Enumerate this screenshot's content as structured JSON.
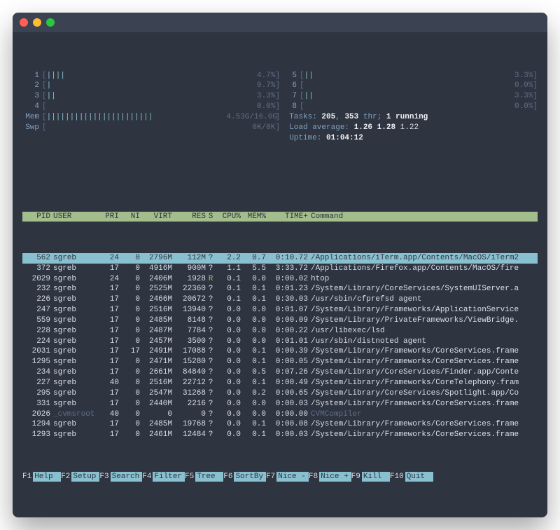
{
  "window": {
    "title": ""
  },
  "colors": {
    "bg": "#2E3440",
    "accent": "#88C0D0",
    "green": "#A3BE8C"
  },
  "cpu_meters": {
    "left": [
      {
        "id": "1",
        "bar": "||||",
        "val": "4.7%"
      },
      {
        "id": "2",
        "bar": "|",
        "val": "0.7%"
      },
      {
        "id": "3",
        "bar": "||",
        "val": "3.3%"
      },
      {
        "id": "4",
        "bar": "",
        "val": "0.0%"
      }
    ],
    "right": [
      {
        "id": "5",
        "bar": "||",
        "val": "3.3%"
      },
      {
        "id": "6",
        "bar": "",
        "val": "0.0%"
      },
      {
        "id": "7",
        "bar": "||",
        "val": "3.3%"
      },
      {
        "id": "8",
        "bar": "",
        "val": "0.0%"
      }
    ]
  },
  "mem": {
    "label": "Mem",
    "bar": "|||||||||||||||||||||||",
    "val": "4.53G/16.0G"
  },
  "swp": {
    "label": "Swp",
    "bar": "",
    "val": "0K/0K"
  },
  "tasks": {
    "label": "Tasks:",
    "procs": "205",
    "thr": "353",
    "suffix": "thr;",
    "running": "1 running"
  },
  "load": {
    "label": "Load average:",
    "a": "1.26",
    "b": "1.28",
    "c": "1.22"
  },
  "uptime": {
    "label": "Uptime:",
    "val": "01:04:12"
  },
  "columns": {
    "pid": "PID",
    "user": "USER",
    "pri": "PRI",
    "ni": "NI",
    "virt": "VIRT",
    "res": "RES",
    "s": "S",
    "cpu": "CPU%",
    "mem": "MEM%",
    "time": "TIME+",
    "cmd": "Command"
  },
  "rows": [
    {
      "sel": true,
      "pid": "562",
      "user": "sgreb",
      "pri": "24",
      "ni": "0",
      "virt": "2796M",
      "res": "112M",
      "s": "?",
      "cpu": "2.2",
      "mem": "0.7",
      "time": "0:10.72",
      "cmd": "/Applications/iTerm.app/Contents/MacOS/iTerm2"
    },
    {
      "pid": "372",
      "user": "sgreb",
      "pri": "17",
      "ni": "0",
      "virt": "4916M",
      "res": "900M",
      "s": "?",
      "cpu": "1.1",
      "mem": "5.5",
      "time": "3:33.72",
      "cmd": "/Applications/Firefox.app/Contents/MacOS/fire"
    },
    {
      "pid": "2029",
      "user": "sgreb",
      "pri": "24",
      "ni": "0",
      "virt": "2406M",
      "res": "1928",
      "s": "R",
      "cpu": "0.1",
      "mem": "0.0",
      "time": "0:00.02",
      "cmd": "htop"
    },
    {
      "pid": "232",
      "user": "sgreb",
      "pri": "17",
      "ni": "0",
      "virt": "2525M",
      "res": "22360",
      "s": "?",
      "cpu": "0.1",
      "mem": "0.1",
      "time": "0:01.23",
      "cmd": "/System/Library/CoreServices/SystemUIServer.a"
    },
    {
      "pid": "226",
      "user": "sgreb",
      "pri": "17",
      "ni": "0",
      "virt": "2466M",
      "res": "20672",
      "s": "?",
      "cpu": "0.1",
      "mem": "0.1",
      "time": "0:30.03",
      "cmd": "/usr/sbin/cfprefsd agent"
    },
    {
      "pid": "247",
      "user": "sgreb",
      "pri": "17",
      "ni": "0",
      "virt": "2516M",
      "res": "13940",
      "s": "?",
      "cpu": "0.0",
      "mem": "0.0",
      "time": "0:01.07",
      "cmd": "/System/Library/Frameworks/ApplicationService"
    },
    {
      "pid": "559",
      "user": "sgreb",
      "pri": "17",
      "ni": "0",
      "virt": "2485M",
      "res": "8148",
      "s": "?",
      "cpu": "0.0",
      "mem": "0.0",
      "time": "0:00.09",
      "cmd": "/System/Library/PrivateFrameworks/ViewBridge."
    },
    {
      "pid": "228",
      "user": "sgreb",
      "pri": "17",
      "ni": "0",
      "virt": "2487M",
      "res": "7784",
      "s": "?",
      "cpu": "0.0",
      "mem": "0.0",
      "time": "0:00.22",
      "cmd": "/usr/libexec/lsd"
    },
    {
      "pid": "224",
      "user": "sgreb",
      "pri": "17",
      "ni": "0",
      "virt": "2457M",
      "res": "3500",
      "s": "?",
      "cpu": "0.0",
      "mem": "0.0",
      "time": "0:01.01",
      "cmd": "/usr/sbin/distnoted agent"
    },
    {
      "pid": "2031",
      "user": "sgreb",
      "pri": "17",
      "ni": "17",
      "virt": "2491M",
      "res": "17088",
      "s": "?",
      "cpu": "0.0",
      "mem": "0.1",
      "time": "0:00.39",
      "cmd": "/System/Library/Frameworks/CoreServices.frame"
    },
    {
      "pid": "1295",
      "user": "sgreb",
      "pri": "17",
      "ni": "0",
      "virt": "2471M",
      "res": "15280",
      "s": "?",
      "cpu": "0.0",
      "mem": "0.1",
      "time": "0:00.05",
      "cmd": "/System/Library/Frameworks/CoreServices.frame"
    },
    {
      "pid": "234",
      "user": "sgreb",
      "pri": "17",
      "ni": "0",
      "virt": "2661M",
      "res": "84840",
      "s": "?",
      "cpu": "0.0",
      "mem": "0.5",
      "time": "0:07.26",
      "cmd": "/System/Library/CoreServices/Finder.app/Conte"
    },
    {
      "pid": "227",
      "user": "sgreb",
      "pri": "40",
      "ni": "0",
      "virt": "2516M",
      "res": "22712",
      "s": "?",
      "cpu": "0.0",
      "mem": "0.1",
      "time": "0:00.49",
      "cmd": "/System/Library/Frameworks/CoreTelephony.fram"
    },
    {
      "pid": "295",
      "user": "sgreb",
      "pri": "17",
      "ni": "0",
      "virt": "2547M",
      "res": "31268",
      "s": "?",
      "cpu": "0.0",
      "mem": "0.2",
      "time": "0:00.65",
      "cmd": "/System/Library/CoreServices/Spotlight.app/Co"
    },
    {
      "pid": "331",
      "user": "sgreb",
      "pri": "17",
      "ni": "0",
      "virt": "2440M",
      "res": "2216",
      "s": "?",
      "cpu": "0.0",
      "mem": "0.0",
      "time": "0:00.03",
      "cmd": "/System/Library/Frameworks/CoreServices.frame"
    },
    {
      "dim": true,
      "pid": "2026",
      "user": "_cvmsroot",
      "pri": "40",
      "ni": "0",
      "virt": "0",
      "res": "0",
      "s": "?",
      "cpu": "0.0",
      "mem": "0.0",
      "time": "0:00.00",
      "cmd": "CVMCompiler"
    },
    {
      "pid": "1294",
      "user": "sgreb",
      "pri": "17",
      "ni": "0",
      "virt": "2485M",
      "res": "19768",
      "s": "?",
      "cpu": "0.0",
      "mem": "0.1",
      "time": "0:00.08",
      "cmd": "/System/Library/Frameworks/CoreServices.frame"
    },
    {
      "pid": "1293",
      "user": "sgreb",
      "pri": "17",
      "ni": "0",
      "virt": "2461M",
      "res": "12484",
      "s": "?",
      "cpu": "0.0",
      "mem": "0.1",
      "time": "0:00.03",
      "cmd": "/System/Library/Frameworks/CoreServices.frame"
    }
  ],
  "fkeys": [
    {
      "k": "F1",
      "lbl": "Help"
    },
    {
      "k": "F2",
      "lbl": "Setup"
    },
    {
      "k": "F3",
      "lbl": "Search"
    },
    {
      "k": "F4",
      "lbl": "Filter"
    },
    {
      "k": "F5",
      "lbl": "Tree"
    },
    {
      "k": "F6",
      "lbl": "SortBy"
    },
    {
      "k": "F7",
      "lbl": "Nice -"
    },
    {
      "k": "F8",
      "lbl": "Nice +"
    },
    {
      "k": "F9",
      "lbl": "Kill"
    },
    {
      "k": "F10",
      "lbl": "Quit"
    }
  ]
}
